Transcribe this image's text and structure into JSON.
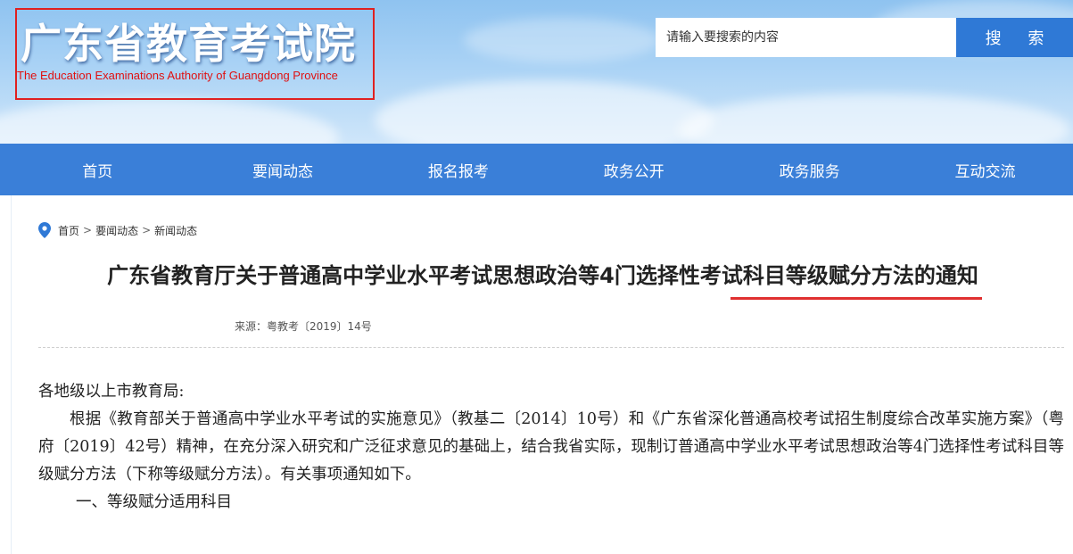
{
  "header": {
    "logo_title": "广东省教育考试院",
    "logo_subtitle": "The Education Examinations Authority of Guangdong Province",
    "search_placeholder": "请输入要搜索的内容",
    "search_button": "搜 索"
  },
  "nav": {
    "items": [
      {
        "label": "首页"
      },
      {
        "label": "要闻动态"
      },
      {
        "label": "报名报考"
      },
      {
        "label": "政务公开"
      },
      {
        "label": "政务服务"
      },
      {
        "label": "互动交流"
      }
    ]
  },
  "breadcrumb": {
    "items": [
      "首页",
      "要闻动态",
      "新闻动态"
    ],
    "separator": ">"
  },
  "article": {
    "title": "广东省教育厅关于普通高中学业水平考试思想政治等4门选择性考试科目等级赋分方法的通知",
    "meta": "来源：粤教考〔2019〕14号",
    "salutation": "各地级以上市教育局:",
    "paragraph1": "根据《教育部关于普通高中学业水平考试的实施意见》（教基二〔2014〕10号）和《广东省深化普通高校考试招生制度综合改革实施方案》（粤府〔2019〕42号）精神，在充分深入研究和广泛征求意见的基础上，结合我省实际，现制订普通高中学业水平考试思想政治等4门选择性考试科目等级赋分方法（下称等级赋分方法）。有关事项通知如下。",
    "section1": "一、等级赋分适用科目"
  },
  "colors": {
    "nav_bg": "#3a7fd8",
    "search_button_bg": "#2f79d6",
    "highlight_red": "#e03030"
  }
}
